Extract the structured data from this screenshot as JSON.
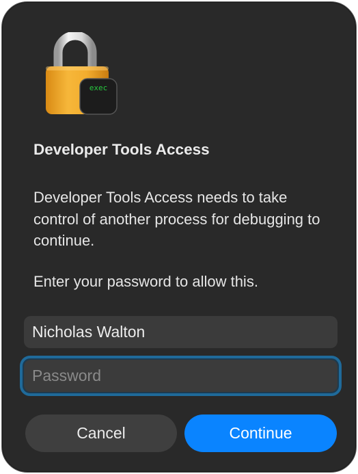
{
  "dialog": {
    "title": "Developer Tools Access",
    "message": "Developer Tools Access needs to take control of another process for debugging to continue.",
    "prompt": "Enter your password to allow this.",
    "icon": {
      "name": "lock-icon",
      "badge_text": "exec",
      "lock_color": "#f0a92c",
      "badge_text_color": "#27c93f"
    },
    "username": {
      "value": "Nicholas Walton"
    },
    "password": {
      "placeholder": "Password",
      "value": ""
    },
    "buttons": {
      "cancel_label": "Cancel",
      "continue_label": "Continue"
    },
    "colors": {
      "accent": "#0a84ff",
      "background": "#292929",
      "focus_ring": "#1f6a9a"
    }
  }
}
